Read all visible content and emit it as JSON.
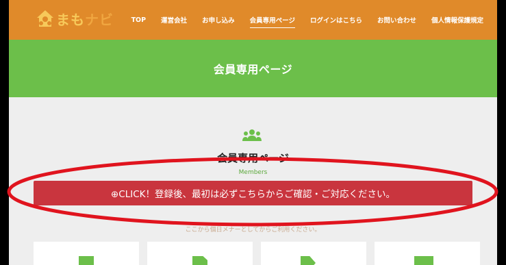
{
  "header": {
    "logo": {
      "icon": "house-logo-icon",
      "text_main": "まも",
      "text_accent": "ナビ"
    },
    "nav": [
      {
        "label": "TOP"
      },
      {
        "label": "運営会社"
      },
      {
        "label": "お申し込み"
      },
      {
        "label": "会員専用ページ",
        "active": true
      },
      {
        "label": "ログインはこちら"
      },
      {
        "label": "お問い合わせ"
      },
      {
        "label": "個人情報保護規定"
      }
    ]
  },
  "hero": {
    "title": "会員専用ページ"
  },
  "members_section": {
    "icon": "users-icon",
    "title": "会員専用ページ",
    "subtitle": "Members",
    "cta_label": "⊕CLICK！登録後、最初は必ずこちらからご確認・ご対応ください。",
    "note": "ここから個日メナーとしてからご利用ください。"
  },
  "cards": [
    {
      "icon": "document-icon"
    },
    {
      "icon": "document-icon"
    },
    {
      "icon": "tag-icon"
    },
    {
      "icon": "box-icon"
    }
  ],
  "colors": {
    "header_bg": "#e08a2a",
    "hero_bg": "#6cbf4a",
    "cta_bg": "#c9353e",
    "annotation": "#e0141e"
  }
}
